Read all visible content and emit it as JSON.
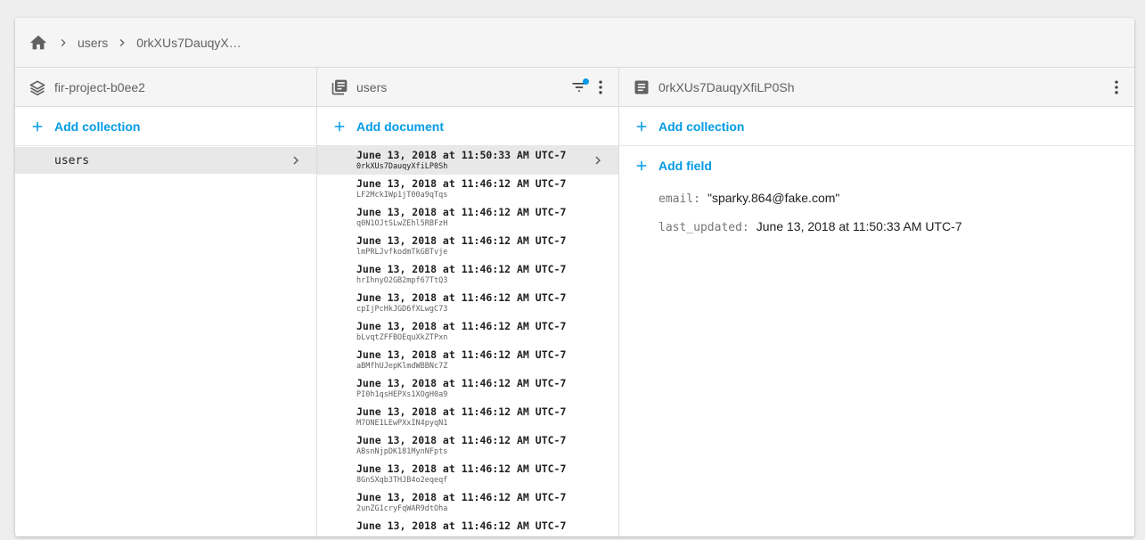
{
  "colors": {
    "accent": "#039be5",
    "header_bg": "#f5f5f5",
    "selected_bg": "#e8e8e8"
  },
  "breadcrumb": {
    "home_icon": "home-icon",
    "items": [
      "users",
      "0rkXUs7DauqyX…"
    ]
  },
  "col1": {
    "icon": "stacks-icon",
    "title": "fir-project-b0ee2",
    "add_label": "Add collection",
    "items": [
      "users"
    ]
  },
  "col2": {
    "icon": "collection-icon",
    "title": "users",
    "filter_icon": "filter-icon",
    "menu_icon": "more-vert-icon",
    "add_label": "Add document",
    "documents": [
      {
        "title": "June 13, 2018 at 11:50:33 AM UTC-7",
        "id": "0rkXUs7DauqyXfiLP0Sh"
      },
      {
        "title": "June 13, 2018 at 11:46:12 AM UTC-7",
        "id": "LF2MckIWp1jT00a9qTqs"
      },
      {
        "title": "June 13, 2018 at 11:46:12 AM UTC-7",
        "id": "q0N1OJtSLwZEhl5RBFzH"
      },
      {
        "title": "June 13, 2018 at 11:46:12 AM UTC-7",
        "id": "lmPRLJvfkodmTkGBTvje"
      },
      {
        "title": "June 13, 2018 at 11:46:12 AM UTC-7",
        "id": "hrIhnyO2GB2mpf67TtQ3"
      },
      {
        "title": "June 13, 2018 at 11:46:12 AM UTC-7",
        "id": "cpIjPcHkJGD6fXLwgC73"
      },
      {
        "title": "June 13, 2018 at 11:46:12 AM UTC-7",
        "id": "bLvqtZFFBOEquXkZTPxn"
      },
      {
        "title": "June 13, 2018 at 11:46:12 AM UTC-7",
        "id": "aBMfhUJepKlmdWBBNc7Z"
      },
      {
        "title": "June 13, 2018 at 11:46:12 AM UTC-7",
        "id": "PI0h1qsHEPXs1XOgH0a9"
      },
      {
        "title": "June 13, 2018 at 11:46:12 AM UTC-7",
        "id": "M7ONE1LEwPXxIN4pyqN1"
      },
      {
        "title": "June 13, 2018 at 11:46:12 AM UTC-7",
        "id": "ABsnNjpDK181MynNFpts"
      },
      {
        "title": "June 13, 2018 at 11:46:12 AM UTC-7",
        "id": "8GnSXqb3THJB4o2eqeqf"
      },
      {
        "title": "June 13, 2018 at 11:46:12 AM UTC-7",
        "id": "2unZG1cryFqWAR9dtOha"
      },
      {
        "title": "June 13, 2018 at 11:46:12 AM UTC-7",
        "id": ""
      }
    ]
  },
  "col3": {
    "icon": "document-icon",
    "title": "0rkXUs7DauqyXfiLP0Sh",
    "menu_icon": "more-vert-icon",
    "add_collection_label": "Add collection",
    "add_field_label": "Add field",
    "fields": [
      {
        "key": "email:",
        "value": "\"sparky.864@fake.com\""
      },
      {
        "key": "last_updated:",
        "value": "June 13, 2018 at 11:50:33 AM UTC-7"
      }
    ]
  }
}
